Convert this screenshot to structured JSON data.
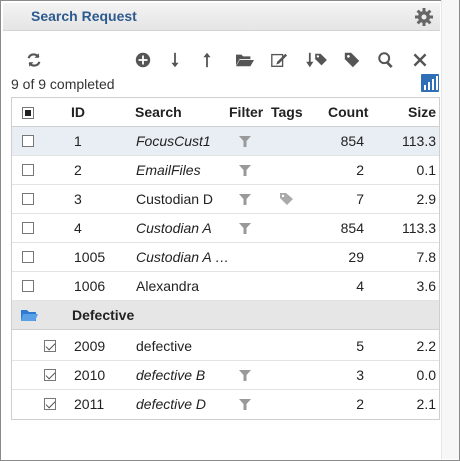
{
  "header": {
    "title": "Search Request"
  },
  "toolbar": {
    "status_text": "9 of 9 completed"
  },
  "columns": {
    "id": "ID",
    "search": "Search",
    "filter": "Filter",
    "tags": "Tags",
    "count": "Count",
    "size": "Size"
  },
  "rows": [
    {
      "id": "1",
      "search": "FocusCust1",
      "italic": true,
      "filter": true,
      "tag": false,
      "count": "854",
      "size": "113.3",
      "selected": true
    },
    {
      "id": "2",
      "search": "EmailFiles",
      "italic": true,
      "filter": true,
      "tag": false,
      "count": "2",
      "size": "0.1"
    },
    {
      "id": "3",
      "search": "Custodian D",
      "italic": false,
      "filter": true,
      "tag": true,
      "count": "7",
      "size": "2.9"
    },
    {
      "id": "4",
      "search": "Custodian A",
      "italic": true,
      "filter": true,
      "tag": false,
      "count": "854",
      "size": "113.3"
    },
    {
      "id": "1005",
      "search": "Custodian A …",
      "italic": true,
      "filter": false,
      "tag": false,
      "count": "29",
      "size": "7.8"
    },
    {
      "id": "1006",
      "search": "Alexandra",
      "italic": false,
      "filter": false,
      "tag": false,
      "count": "4",
      "size": "3.6"
    }
  ],
  "group": {
    "title": "Defective"
  },
  "group_rows": [
    {
      "id": "2009",
      "search": "defective",
      "italic": false,
      "filter": false,
      "count": "5",
      "size": "2.2"
    },
    {
      "id": "2010",
      "search": "defective B",
      "italic": true,
      "filter": true,
      "count": "3",
      "size": "0.0"
    },
    {
      "id": "2011",
      "search": "defective D",
      "italic": true,
      "filter": true,
      "count": "2",
      "size": "2.1"
    }
  ],
  "icons": [
    "refresh-icon",
    "add-icon",
    "arrow-down-icon",
    "arrow-up-icon",
    "folder-open-icon",
    "edit-icon",
    "sort-tag-icon",
    "tag-icon",
    "search-icon",
    "close-icon",
    "chart-icon",
    "gear-icon",
    "filter-icon",
    "folder-icon"
  ],
  "colors": {
    "title": "#2d5a8e",
    "selected_row": "#e9eef4",
    "group_row": "#e6e6e6",
    "chart_icon": "#2e6fb5"
  }
}
